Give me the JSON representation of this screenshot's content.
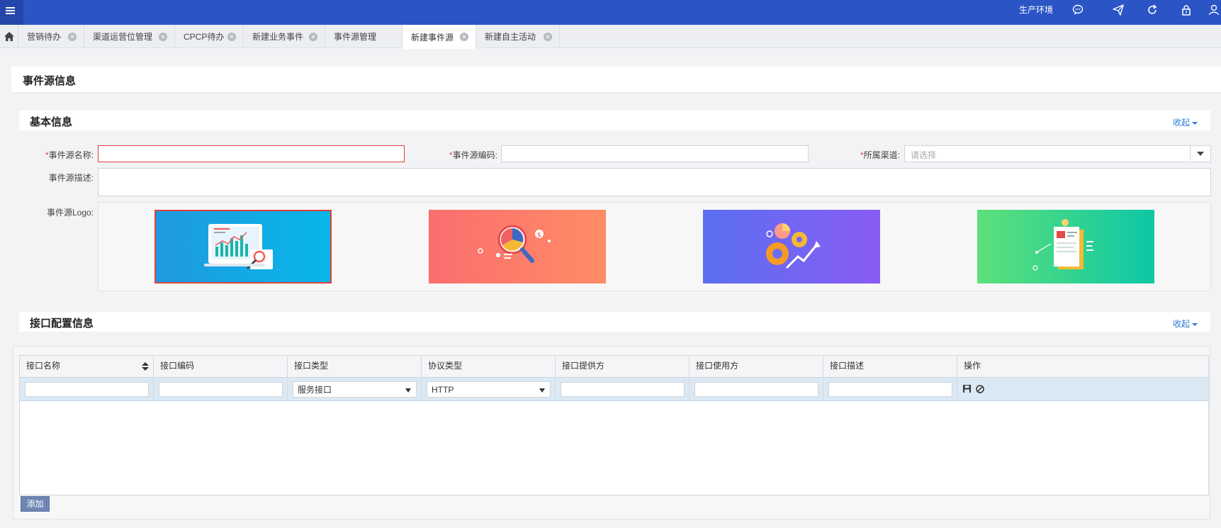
{
  "topbar": {
    "env_label": "生产环境",
    "icons": [
      "message-icon",
      "send-icon",
      "refresh-icon",
      "lock-icon",
      "user-icon"
    ]
  },
  "tabs": [
    {
      "label": "营销待办"
    },
    {
      "label": "渠道运营位管理"
    },
    {
      "label": "CPCP待办"
    },
    {
      "label": "新建业务事件"
    },
    {
      "label": "事件源管理"
    },
    {
      "label": "新建事件源",
      "active": true
    },
    {
      "label": "新建自主活动"
    }
  ],
  "page": {
    "title": "事件源信息"
  },
  "basic": {
    "title": "基本信息",
    "collapse": "收起",
    "required_mark": "*",
    "name_label": "事件源名称:",
    "code_label": "事件源编码:",
    "channel_label": "所属渠道:",
    "channel_placeholder": "请选择",
    "desc_label": "事件源描述:",
    "logo_label": "事件源Logo:",
    "logos": [
      {
        "name": "analytics-monitor",
        "selected": true,
        "color_from": "#1f9ae0",
        "color_to": "#08b6e8"
      },
      {
        "name": "magnifier-pie",
        "selected": false,
        "color_from": "#fa6e6e",
        "color_to": "#ff8c66"
      },
      {
        "name": "gears-growth",
        "selected": false,
        "color_from": "#5a6ff0",
        "color_to": "#8a5cf5"
      },
      {
        "name": "clipboard-idea",
        "selected": false,
        "color_from": "#5ee07a",
        "color_to": "#0dc7a5"
      }
    ]
  },
  "interface": {
    "title": "接口配置信息",
    "collapse": "收起",
    "columns": [
      "接口名称",
      "接口编码",
      "接口类型",
      "协议类型",
      "接口提供方",
      "接口使用方",
      "接口描述",
      "操作"
    ],
    "row": {
      "type": "服务接口",
      "protocol": "HTTP"
    },
    "add_label": "添加"
  },
  "colors": {
    "topbar": "#2b55c5",
    "accent": "#2b7bd9",
    "error": "#e0403d"
  }
}
